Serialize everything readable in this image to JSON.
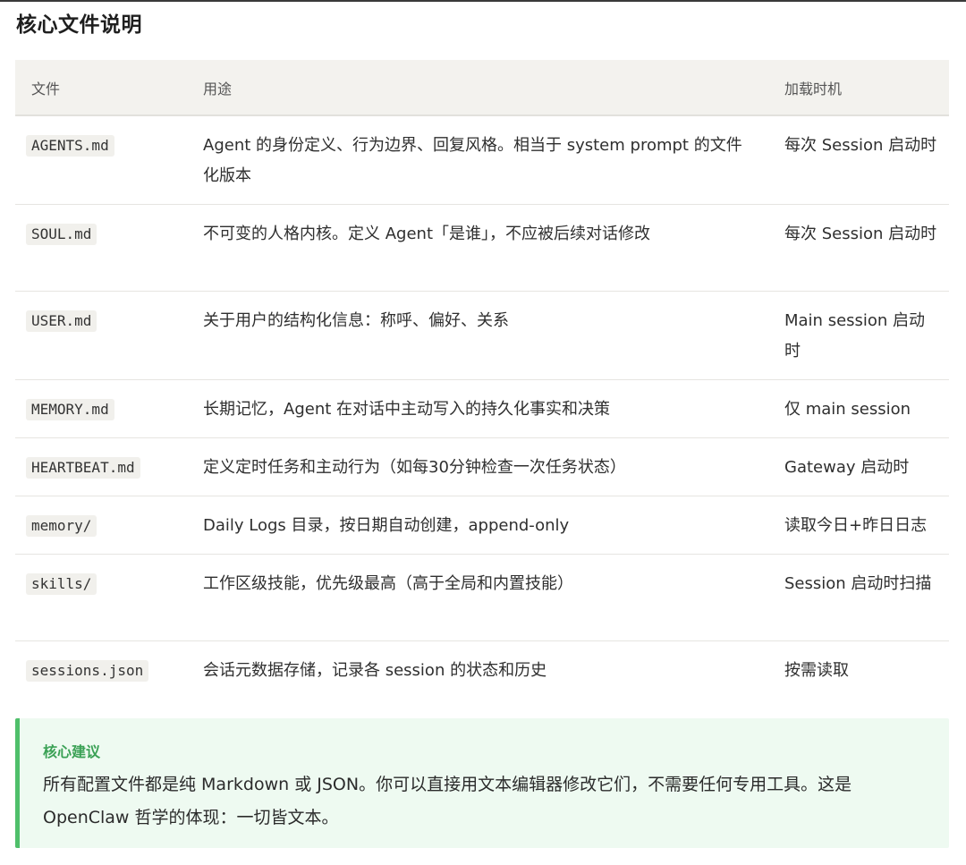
{
  "title": "核心文件说明",
  "table": {
    "headers": [
      "文件",
      "用途",
      "加载时机"
    ],
    "rows": [
      {
        "file": "AGENTS.md",
        "purpose": "Agent 的身份定义、行为边界、回复风格。相当于 system prompt 的文件化版本",
        "timing": "每次 Session 启动时"
      },
      {
        "file": "SOUL.md",
        "purpose": "不可变的人格内核。定义 Agent「是谁」，不应被后续对话修改",
        "timing": "每次 Session 启动时"
      },
      {
        "file": "USER.md",
        "purpose": "关于用户的结构化信息：称呼、偏好、关系",
        "timing": "Main session 启动时"
      },
      {
        "file": "MEMORY.md",
        "purpose": "长期记忆，Agent 在对话中主动写入的持久化事实和决策",
        "timing": "仅 main session"
      },
      {
        "file": "HEARTBEAT.md",
        "purpose": "定义定时任务和主动行为（如每30分钟检查一次任务状态）",
        "timing": "Gateway 启动时"
      },
      {
        "file": "memory/",
        "purpose": "Daily Logs 目录，按日期自动创建，append-only",
        "timing": "读取今日+昨日日志"
      },
      {
        "file": "skills/",
        "purpose": "工作区级技能，优先级最高（高于全局和内置技能）",
        "timing": "Session 启动时扫描"
      },
      {
        "file": "sessions.json",
        "purpose": "会话元数据存储，记录各 session 的状态和历史",
        "timing": "按需读取"
      }
    ]
  },
  "tip": {
    "title": "核心建议",
    "body": "所有配置文件都是纯 Markdown 或 JSON。你可以直接用文本编辑器修改它们，不需要任何专用工具。这是 OpenClaw 哲学的体现：一切皆文本。"
  },
  "colors": {
    "tip_accent": "#4fbf6a",
    "tip_background": "#eefaf1",
    "header_background": "#f3f2ee"
  }
}
